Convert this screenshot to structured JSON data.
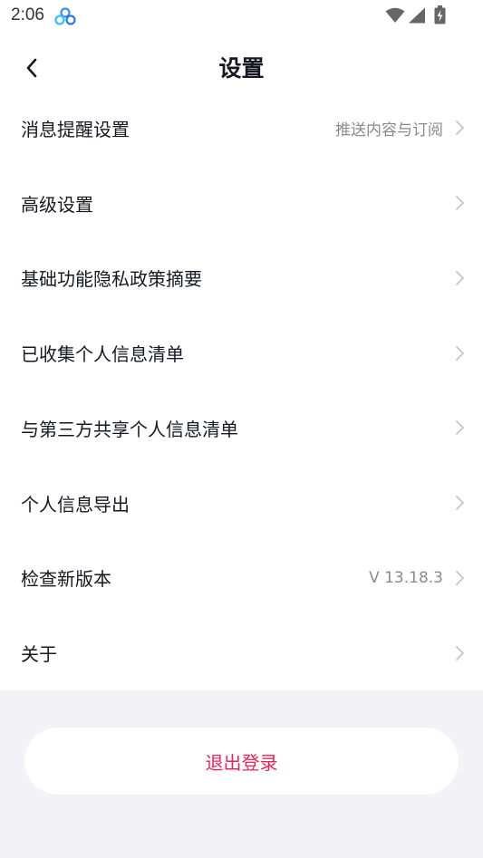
{
  "status_bar": {
    "time": "2:06"
  },
  "header": {
    "title": "设置"
  },
  "settings": {
    "items": [
      {
        "label": "消息提醒设置",
        "value": "推送内容与订阅"
      },
      {
        "label": "高级设置",
        "value": ""
      },
      {
        "label": "基础功能隐私政策摘要",
        "value": ""
      },
      {
        "label": "已收集个人信息清单",
        "value": ""
      },
      {
        "label": "与第三方共享个人信息清单",
        "value": ""
      },
      {
        "label": "个人信息导出",
        "value": ""
      },
      {
        "label": "检查新版本",
        "value": "V 13.18.3"
      },
      {
        "label": "关于",
        "value": ""
      }
    ]
  },
  "logout": {
    "label": "退出登录"
  },
  "colors": {
    "accent": "#e8245a",
    "text_primary": "#161823",
    "text_secondary": "#8a8b91",
    "background": "#f2f2f7"
  },
  "icons": {
    "back": "back-arrow-icon",
    "chevron": "chevron-right-icon",
    "wifi": "wifi-icon",
    "signal": "cellular-signal-icon",
    "battery": "battery-charging-icon",
    "app_notification": "cloud-app-icon"
  }
}
